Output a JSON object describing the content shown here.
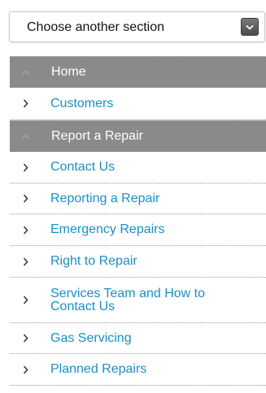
{
  "section_select": {
    "label": "Choose another section"
  },
  "nav": {
    "home": {
      "label": "Home"
    },
    "customers": {
      "label": "Customers"
    },
    "report_repair": {
      "label": "Report a Repair"
    },
    "items": [
      {
        "label": "Contact Us"
      },
      {
        "label": "Reporting a Repair"
      },
      {
        "label": "Emergency Repairs"
      },
      {
        "label": "Right to Repair"
      },
      {
        "label": "Services Team and How to Contact Us"
      },
      {
        "label": "Gas Servicing"
      },
      {
        "label": "Planned Repairs"
      }
    ]
  },
  "colors": {
    "link": "#1b8fc6",
    "section_bg": "#8a8a8a"
  }
}
